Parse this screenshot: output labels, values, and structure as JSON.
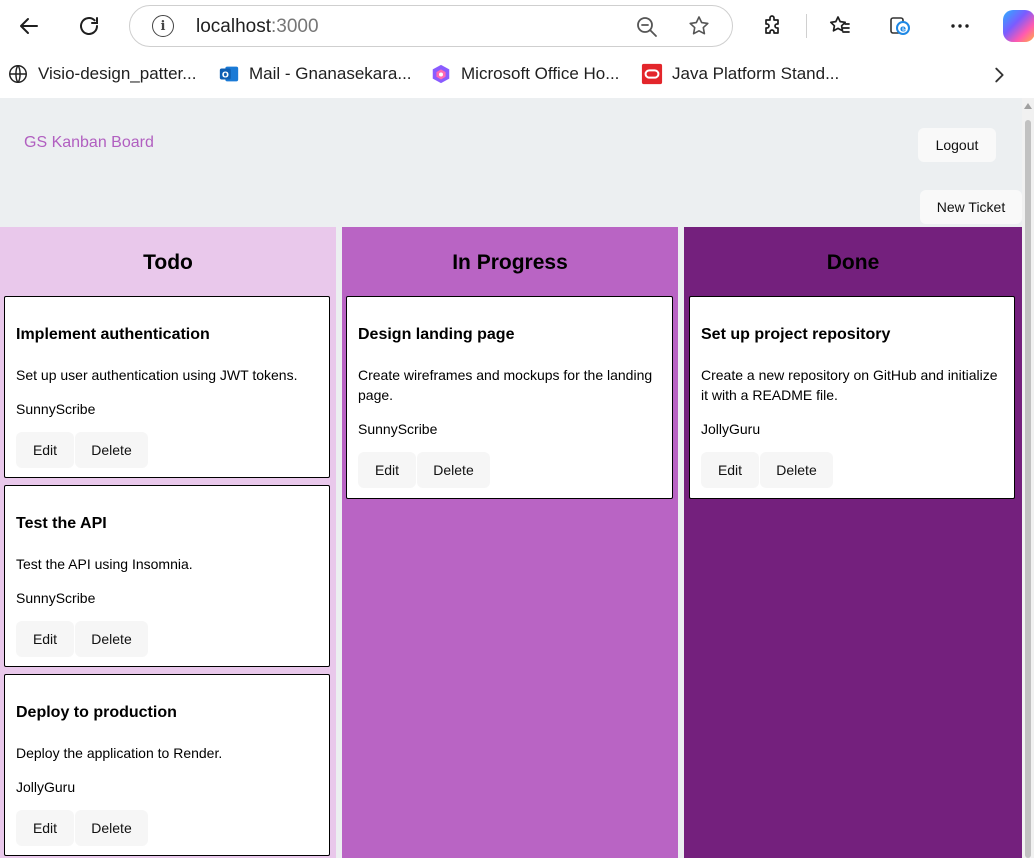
{
  "browser": {
    "url_host": "localhost",
    "url_port": ":3000",
    "bookmarks": [
      {
        "label": "Visio-design_patter...",
        "icon": "globe-icon"
      },
      {
        "label": "Mail - Gnanasekara...",
        "icon": "outlook-icon"
      },
      {
        "label": "Microsoft Office Ho...",
        "icon": "office-icon"
      },
      {
        "label": "Java Platform Stand...",
        "icon": "oracle-icon"
      }
    ]
  },
  "app": {
    "brand": "GS Kanban Board",
    "logout_label": "Logout",
    "new_ticket_label": "New Ticket"
  },
  "columns": [
    {
      "title": "Todo",
      "color": "#e9c8eb",
      "cards": [
        {
          "title": "Implement authentication",
          "description": "Set up user authentication using JWT tokens.",
          "user": "SunnyScribe",
          "edit": "Edit",
          "delete": "Delete"
        },
        {
          "title": "Test the API",
          "description": "Test the API using Insomnia.",
          "user": "SunnyScribe",
          "edit": "Edit",
          "delete": "Delete"
        },
        {
          "title": "Deploy to production",
          "description": "Deploy the application to Render.",
          "user": "JollyGuru",
          "edit": "Edit",
          "delete": "Delete"
        }
      ]
    },
    {
      "title": "In Progress",
      "color": "#b964c4",
      "cards": [
        {
          "title": "Design landing page",
          "description": "Create wireframes and mockups for the landing page.",
          "user": "SunnyScribe",
          "edit": "Edit",
          "delete": "Delete"
        }
      ]
    },
    {
      "title": "Done",
      "color": "#74207d",
      "cards": [
        {
          "title": "Set up project repository",
          "description": "Create a new repository on GitHub and initialize it with a README file.",
          "user": "JollyGuru",
          "edit": "Edit",
          "delete": "Delete"
        }
      ]
    }
  ]
}
